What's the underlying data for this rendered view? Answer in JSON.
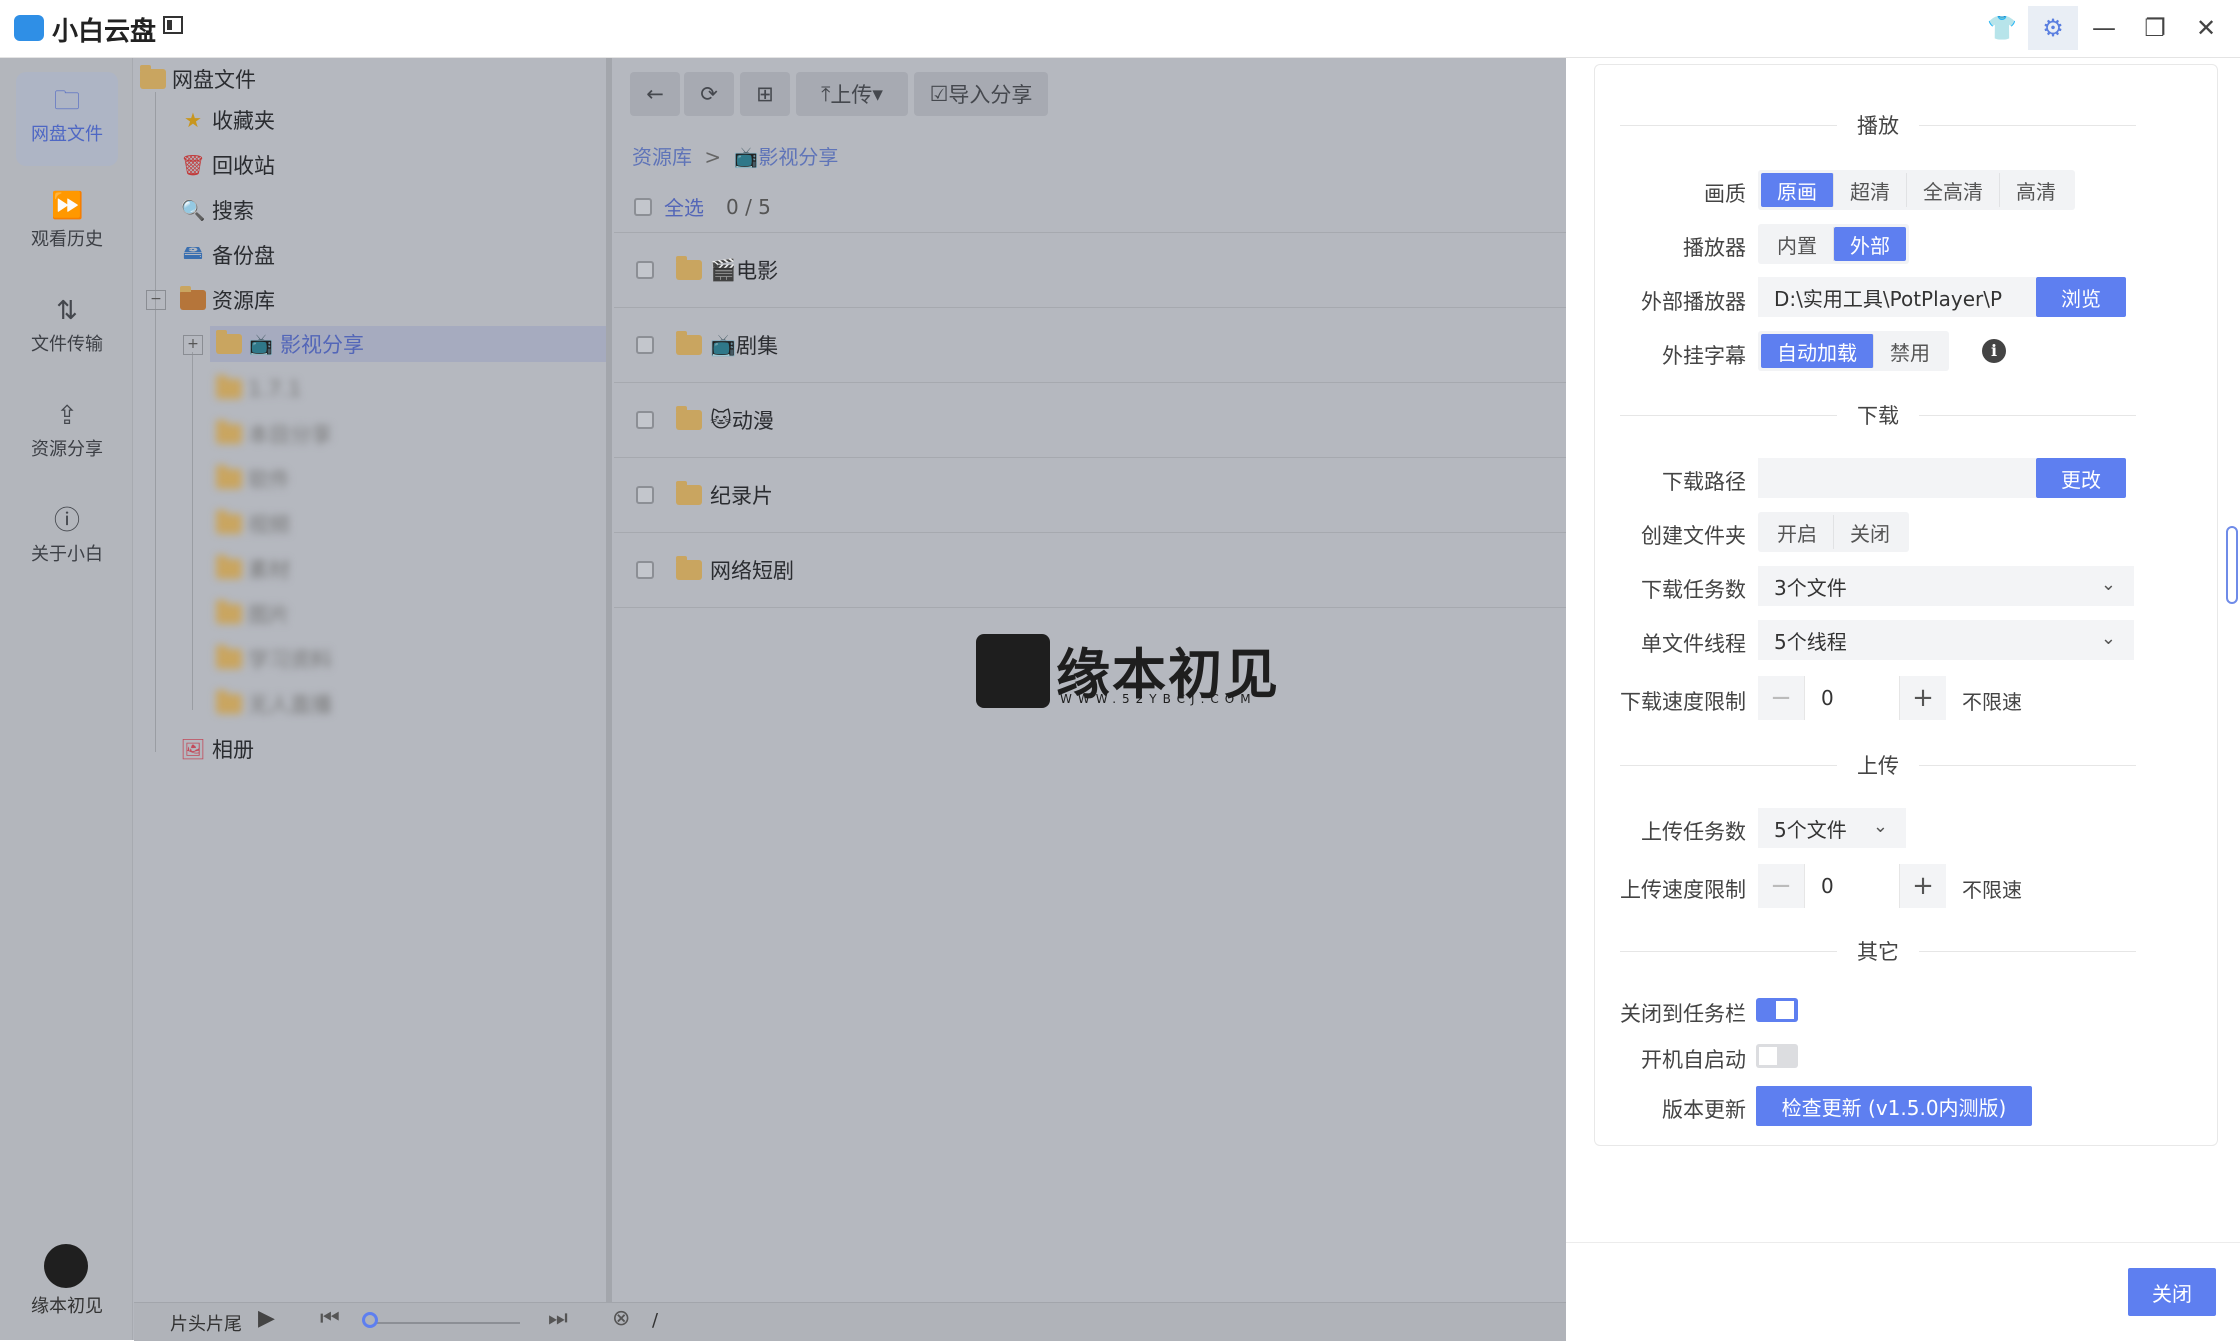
{
  "app": {
    "title": "小白云盘"
  },
  "nav": [
    {
      "label": "网盘文件",
      "icon": "folder-icon"
    },
    {
      "label": "观看历史",
      "icon": "play-history-icon"
    },
    {
      "label": "文件传输",
      "icon": "transfer-icon"
    },
    {
      "label": "资源分享",
      "icon": "share-icon"
    },
    {
      "label": "关于小白",
      "icon": "info-icon"
    }
  ],
  "brand": {
    "label": "缘本初见"
  },
  "tree": {
    "root": "网盘文件",
    "favorites": "收藏夹",
    "recycle": "回收站",
    "search": "搜索",
    "backup": "备份盘",
    "library": "资源库",
    "selected": "影视分享",
    "blurred": [
      "1.7.1",
      "本目分享",
      "软件",
      "视频",
      "素材",
      "图片",
      "学习资料",
      "无人直播"
    ],
    "album": "相册"
  },
  "toolbar": {
    "upload": "上传",
    "import_share": "导入分享"
  },
  "breadcrumb": {
    "root": "资源库",
    "sep": ">",
    "current": "影视分享"
  },
  "selection": {
    "select_all": "全选",
    "count": "0 / 5"
  },
  "files": [
    {
      "name": "电影",
      "prefix": "🎬"
    },
    {
      "name": "剧集",
      "prefix": "📺"
    },
    {
      "name": "动漫",
      "prefix": "🐱"
    },
    {
      "name": "纪录片",
      "prefix": ""
    },
    {
      "name": "网络短剧",
      "prefix": ""
    }
  ],
  "watermark": {
    "text": "缘本初见",
    "url": "WWW.52YBCJ.COM"
  },
  "player": {
    "label": "片头片尾",
    "path": "/"
  },
  "settings": {
    "play": {
      "title": "播放",
      "quality_label": "画质",
      "quality_options": [
        "原画",
        "超清",
        "全高清",
        "高清"
      ],
      "quality_selected": 0,
      "player_label": "播放器",
      "player_options": [
        "内置",
        "外部"
      ],
      "player_selected": 1,
      "external_player_label": "外部播放器",
      "external_player_path": "D:\\实用工具\\PotPlayer\\P",
      "browse": "浏览",
      "subtitle_label": "外挂字幕",
      "subtitle_options": [
        "自动加载",
        "禁用"
      ],
      "subtitle_selected": 0
    },
    "download": {
      "title": "下载",
      "path_label": "下载路径",
      "path_value": "",
      "change": "更改",
      "create_folder_label": "创建文件夹",
      "create_folder_options": [
        "开启",
        "关闭"
      ],
      "tasks_label": "下载任务数",
      "tasks_value": "3个文件",
      "threads_label": "单文件线程",
      "threads_value": "5个线程",
      "speed_label": "下载速度限制",
      "speed_value": "0",
      "speed_unit": "不限速"
    },
    "upload": {
      "title": "上传",
      "tasks_label": "上传任务数",
      "tasks_value": "5个文件",
      "speed_label": "上传速度限制",
      "speed_value": "0",
      "speed_unit": "不限速"
    },
    "other": {
      "title": "其它",
      "tray_label": "关闭到任务栏",
      "tray_on": true,
      "autostart_label": "开机自启动",
      "autostart_on": false,
      "update_label": "版本更新",
      "update_button": "检查更新 (v1.5.0内测版)"
    },
    "close": "关闭"
  },
  "colors": {
    "accent": "#5e7ff0",
    "dim": "#b5b8bf",
    "folder": "#c9a560"
  }
}
